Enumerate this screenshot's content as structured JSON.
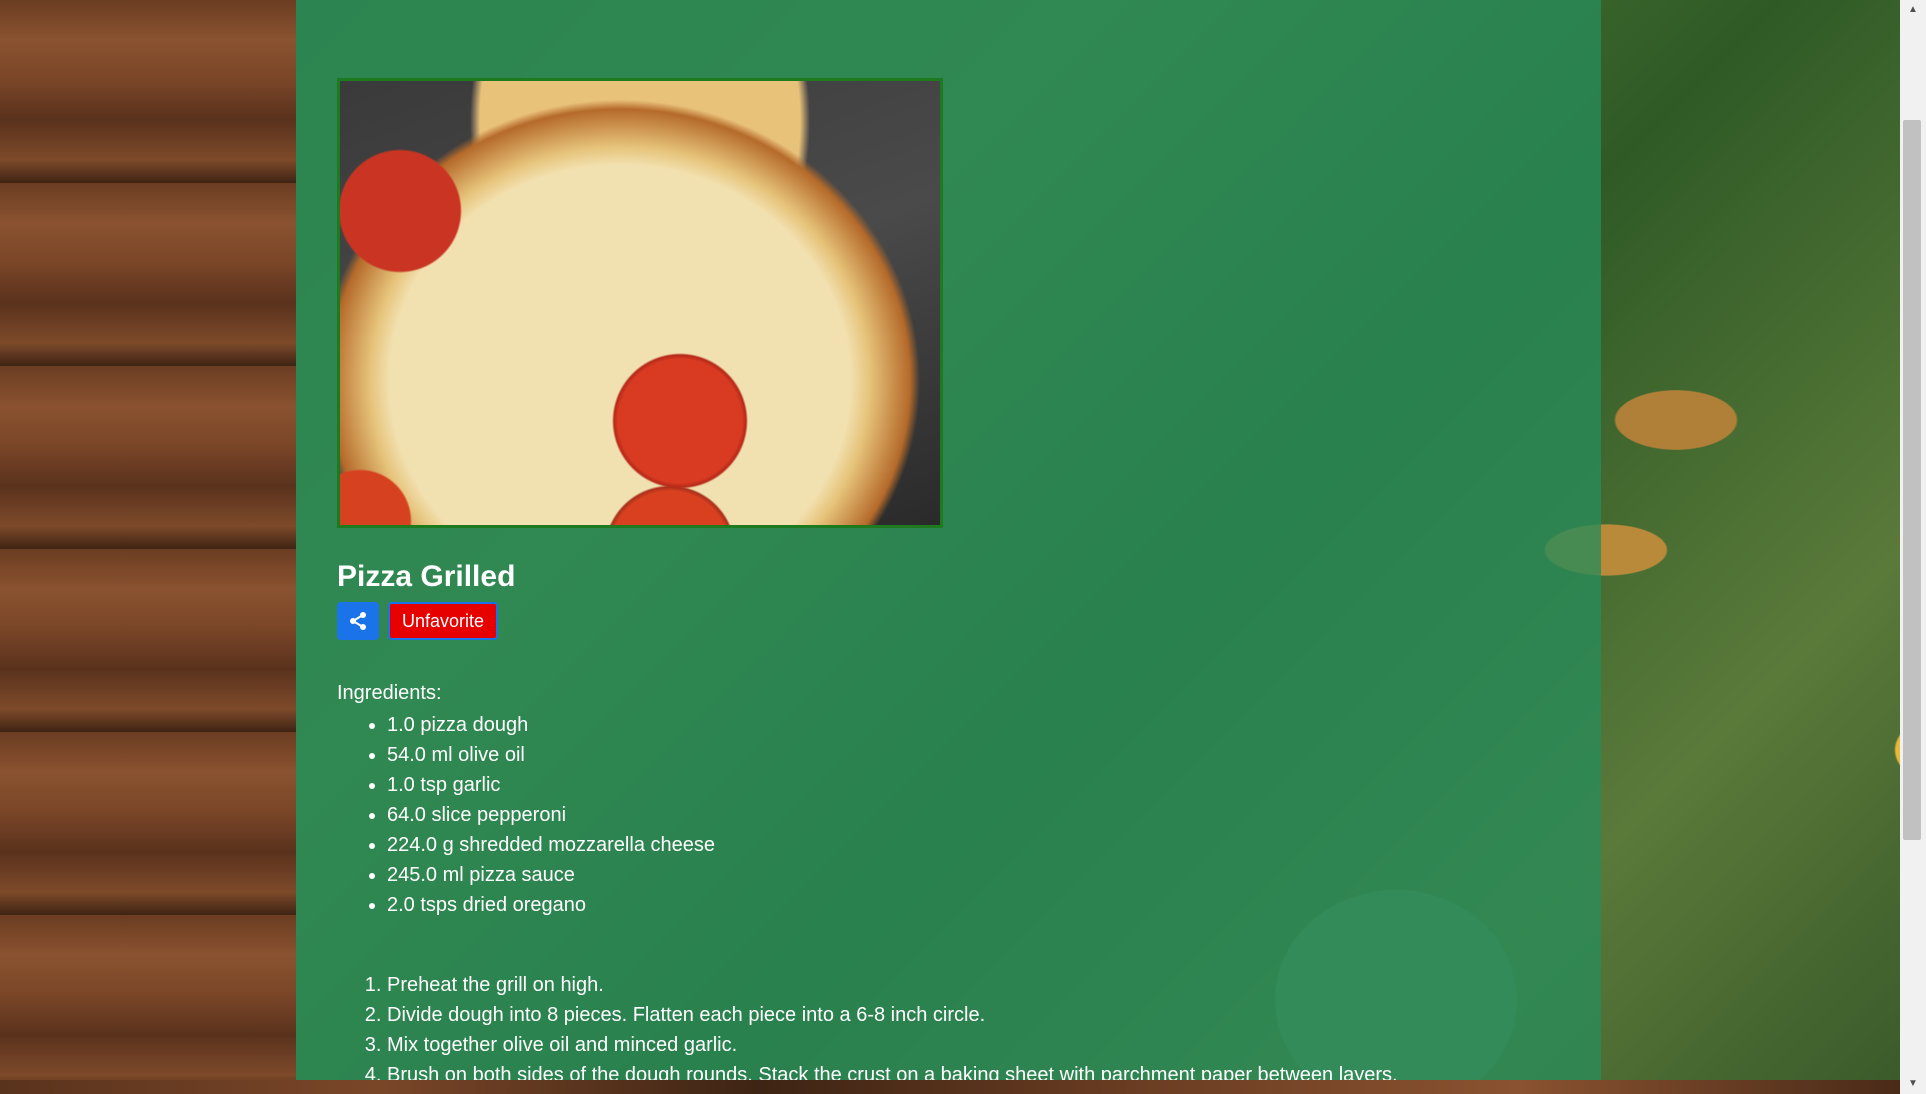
{
  "recipe": {
    "title": "Pizza Grilled",
    "image_alt": "Pizza Grilled",
    "actions": {
      "share_icon": "share-icon",
      "unfavorite_label": "Unfavorite"
    },
    "ingredients_label": "Ingredients:",
    "ingredients": [
      "1.0 pizza dough",
      "54.0 ml olive oil",
      "1.0 tsp garlic",
      "64.0 slice pepperoni",
      "224.0 g shredded mozzarella cheese",
      "245.0 ml pizza sauce",
      "2.0 tsps dried oregano"
    ],
    "steps": [
      "Preheat the grill on high.",
      "Divide dough into 8 pieces. Flatten each piece into a 6-8 inch circle.",
      "Mix together olive oil and minced garlic.",
      "Brush on both sides of the dough rounds. Stack the crust on a baking sheet with parchment paper between layers."
    ]
  },
  "colors": {
    "panel_overlay": "#288c5a",
    "share_button": "#1a73e8",
    "unfavorite_button": "#e60000",
    "image_border": "#1e7a1e"
  }
}
